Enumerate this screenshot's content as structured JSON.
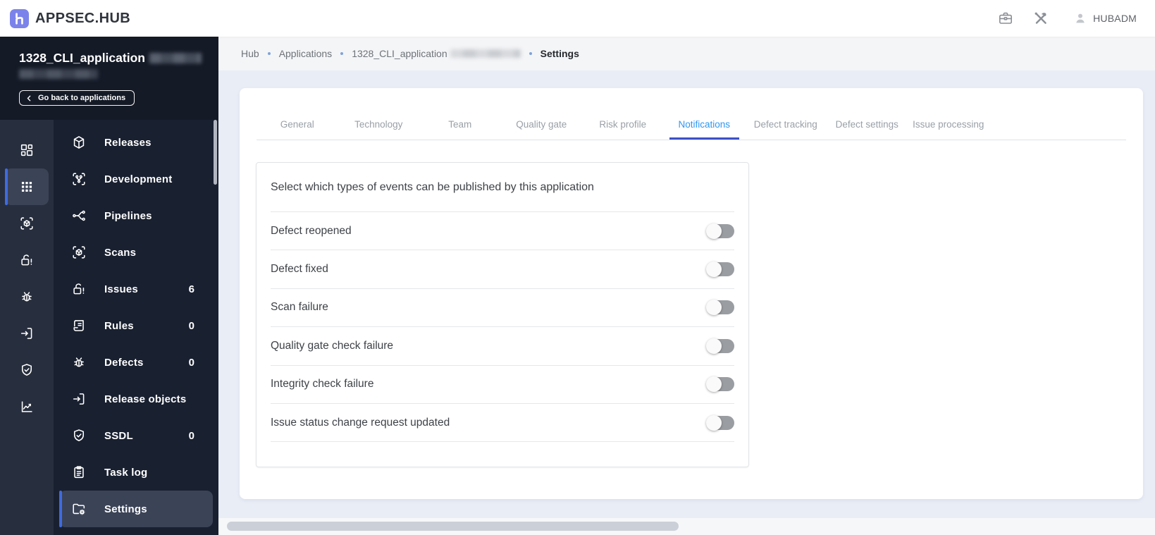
{
  "topbar": {
    "logo_text": "APPSEC.HUB",
    "user_name": "HUBADM"
  },
  "sidebar": {
    "app_name": "1328_CLI_application",
    "back_button_label": "Go back to applications",
    "rail_items": [
      {
        "icon": "dashboard-icon",
        "active": false
      },
      {
        "icon": "apps-grid-icon",
        "active": true
      },
      {
        "icon": "scan-cube-icon",
        "active": false
      },
      {
        "icon": "unlock-alert-icon",
        "active": false
      },
      {
        "icon": "bug-icon",
        "active": false
      },
      {
        "icon": "exit-box-icon",
        "active": false
      },
      {
        "icon": "shield-check-icon",
        "active": false
      },
      {
        "icon": "line-chart-icon",
        "active": false
      }
    ],
    "nav_items": [
      {
        "label": "Releases",
        "icon": "releases-icon",
        "badge": "",
        "active": false
      },
      {
        "label": "Development",
        "icon": "development-icon",
        "badge": "",
        "active": false
      },
      {
        "label": "Pipelines",
        "icon": "pipelines-icon",
        "badge": "",
        "active": false
      },
      {
        "label": "Scans",
        "icon": "scan-cube-icon",
        "badge": "",
        "active": false
      },
      {
        "label": "Issues",
        "icon": "unlock-alert-icon",
        "badge": "6",
        "active": false
      },
      {
        "label": "Rules",
        "icon": "rules-icon",
        "badge": "0",
        "active": false
      },
      {
        "label": "Defects",
        "icon": "bug-icon",
        "badge": "0",
        "active": false
      },
      {
        "label": "Release objects",
        "icon": "exit-box-icon",
        "badge": "",
        "active": false
      },
      {
        "label": "SSDL",
        "icon": "shield-check-icon",
        "badge": "0",
        "active": false
      },
      {
        "label": "Task log",
        "icon": "task-log-icon",
        "badge": "",
        "active": false
      },
      {
        "label": "Settings",
        "icon": "folder-gear-icon",
        "badge": "",
        "active": true
      }
    ]
  },
  "breadcrumb": {
    "items": [
      {
        "label": "Hub",
        "current": false,
        "redacted_suffix": false
      },
      {
        "label": "Applications",
        "current": false,
        "redacted_suffix": false
      },
      {
        "label": "1328_CLI_application",
        "current": false,
        "redacted_suffix": true
      },
      {
        "label": "Settings",
        "current": true,
        "redacted_suffix": false
      }
    ]
  },
  "tabs": [
    {
      "label": "General",
      "active": false
    },
    {
      "label": "Technology",
      "active": false
    },
    {
      "label": "Team",
      "active": false
    },
    {
      "label": "Quality gate",
      "active": false
    },
    {
      "label": "Risk profile",
      "active": false
    },
    {
      "label": "Notifications",
      "active": true
    },
    {
      "label": "Defect tracking",
      "active": false
    },
    {
      "label": "Defect settings",
      "active": false
    },
    {
      "label": "Issue processing",
      "active": false
    }
  ],
  "settings_panel": {
    "section_title": "Select which types of events can be published by this application",
    "event_toggles": [
      {
        "label": "Defect reopened",
        "enabled": false
      },
      {
        "label": "Defect fixed",
        "enabled": false
      },
      {
        "label": "Scan failure",
        "enabled": false
      },
      {
        "label": "Quality gate check failure",
        "enabled": false
      },
      {
        "label": "Integrity check failure",
        "enabled": false
      },
      {
        "label": "Issue status change request updated",
        "enabled": false
      }
    ]
  },
  "colors": {
    "accent_blue": "#3e6be0",
    "tab_active_text": "#2f96f3",
    "tab_indicator": "#3b51c6",
    "logo_purple": "#7b83ea",
    "sidebar_dark": "#192030",
    "sidebar_header_dark": "#141a26",
    "rail_dark": "#272e3d",
    "active_item_bg": "#3b4356",
    "content_bg": "#e9edf6",
    "toggle_off_track": "#9a9da1"
  }
}
